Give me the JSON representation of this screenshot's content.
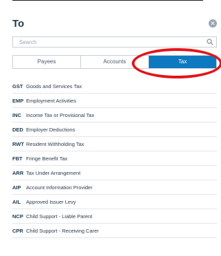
{
  "dialog": {
    "title": "To",
    "close_icon": "close-icon"
  },
  "search": {
    "placeholder": "Search",
    "icon": "search-icon"
  },
  "tabs": [
    {
      "label": "Payees",
      "active": false
    },
    {
      "label": "Accounts",
      "active": false
    },
    {
      "label": "Tax",
      "active": true
    }
  ],
  "colors": {
    "active_tab": "#0c79c0",
    "highlight_ring": "#e3141b",
    "title": "#1b3a52"
  },
  "tax_types": [
    {
      "code": "GST",
      "label": "Goods and Services Tax"
    },
    {
      "code": "EMP",
      "label": "Employment Activities"
    },
    {
      "code": "INC",
      "label": "Income Tax or Provisional Tax"
    },
    {
      "code": "DED",
      "label": "Employer Deductions"
    },
    {
      "code": "RWT",
      "label": "Resident Withholding Tax"
    },
    {
      "code": "FBT",
      "label": "Fringe Benefit Tax"
    },
    {
      "code": "ARR",
      "label": "Tax Under Arrangement"
    },
    {
      "code": "AIP",
      "label": "Account Information Provider"
    },
    {
      "code": "AIL",
      "label": "Approved Issuer Levy"
    },
    {
      "code": "NCP",
      "label": "Child Support - Liable Parent"
    },
    {
      "code": "CPR",
      "label": "Child Support - Receiving Carer"
    }
  ]
}
